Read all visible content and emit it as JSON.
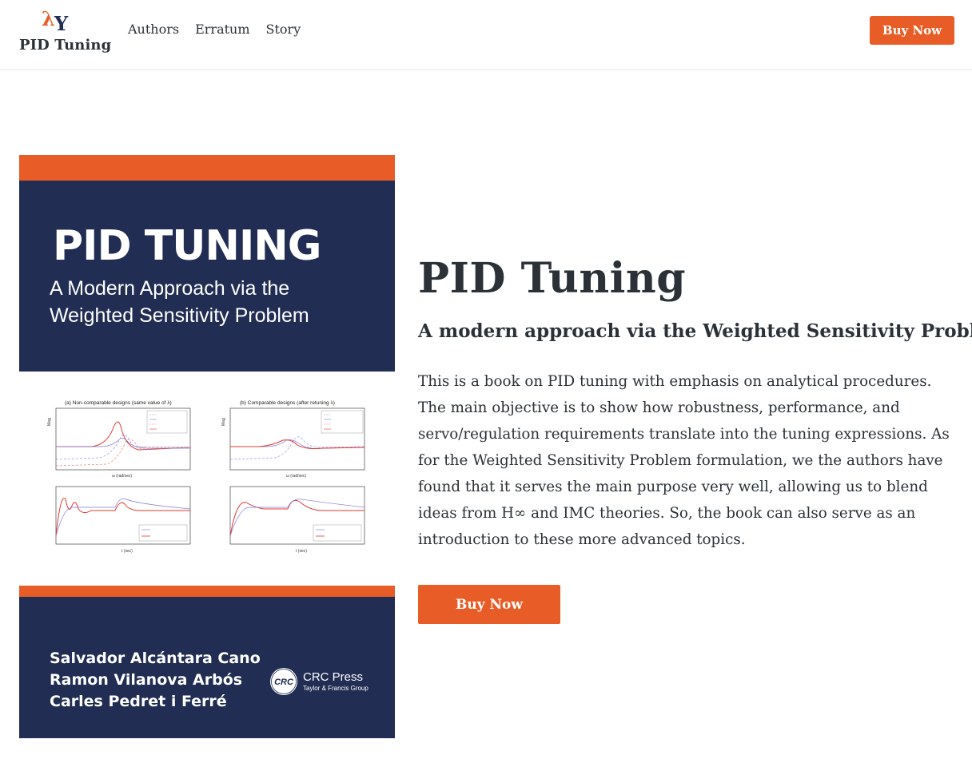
{
  "header": {
    "logo_icon": "lambda-y-logo",
    "brand_name": "PID Tuning",
    "nav": [
      "Authors",
      "Erratum",
      "Story"
    ],
    "buy_label": "Buy Now"
  },
  "cover": {
    "title": "PID TUNING",
    "subtitle": "A Modern Approach via the Weighted Sensitivity Problem",
    "plot_a_title": "(a) Non-comparable designs (same value of λ)",
    "plot_b_title": "(b) Comparable designs (after retuning λ)",
    "authors": [
      "Salvador Alcántara Cano",
      "Ramon Vilanova Arbós",
      "Carles Pedret i Ferré"
    ],
    "publisher_name": "CRC Press",
    "publisher_group": "Taylor & Francis Group",
    "publisher_logo": "CRC"
  },
  "main": {
    "title": "PID Tuning",
    "subtitle": "A modern approach via the Weighted Sensitivity Problem",
    "description": "This is a book on PID tuning with emphasis on analytical procedures. The main objective is to show how robustness, performance, and servo/regulation requirements translate into the tuning expressions. As for the Weighted Sensitivity Problem formulation, we the authors have found that it serves the main purpose very well, allowing us to blend ideas from H∞ and IMC theories. So, the book can also serve as an introduction to these more advanced topics.",
    "buy_label": "Buy Now"
  },
  "colors": {
    "accent": "#e85d27",
    "navy": "#212d52",
    "text": "#2b3137"
  }
}
